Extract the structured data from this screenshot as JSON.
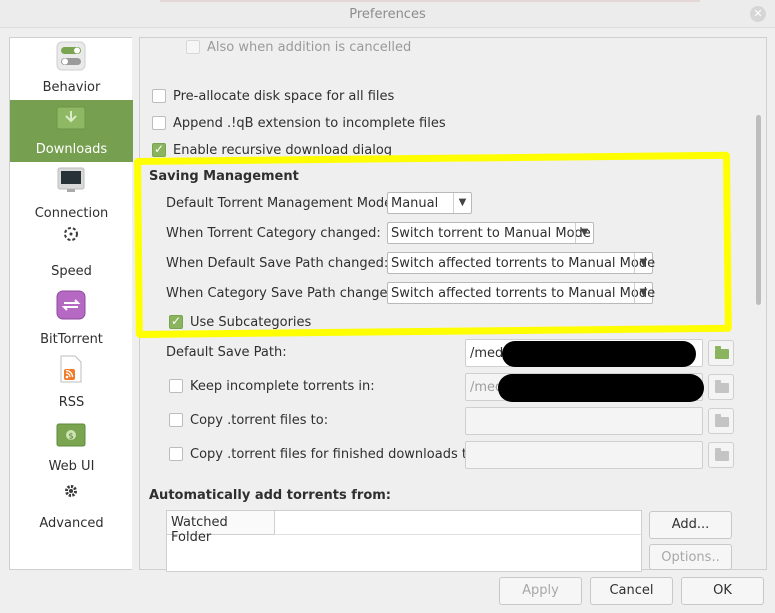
{
  "window": {
    "title": "Preferences"
  },
  "sidebar": {
    "items": [
      {
        "label": "Behavior"
      },
      {
        "label": "Downloads"
      },
      {
        "label": "Connection"
      },
      {
        "label": "Speed"
      },
      {
        "label": "BitTorrent"
      },
      {
        "label": "RSS"
      },
      {
        "label": "Web UI"
      },
      {
        "label": "Advanced"
      }
    ]
  },
  "main": {
    "also_cancelled": "Also when addition is cancelled",
    "preallocate": "Pre-allocate disk space for all files",
    "append_ext": "Append .!qB extension to incomplete files",
    "recursive": "Enable recursive download dialog",
    "saving": {
      "heading": "Saving Management",
      "mode_label": "Default Torrent Management Mode:",
      "mode_value": "Manual",
      "cat_changed_label": "When Torrent Category changed:",
      "cat_changed_value": "Switch torrent to Manual Mode",
      "default_path_changed_label": "When Default Save Path changed:",
      "default_path_changed_value": "Switch affected torrents to Manual Mode",
      "cat_path_changed_label": "When Category Save Path changed:",
      "cat_path_changed_value": "Switch affected torrents to Manual Mode",
      "subcategories": "Use Subcategories"
    },
    "default_save_path_label": "Default Save Path:",
    "default_save_path_value": "/med",
    "keep_incomplete_label": "Keep incomplete torrents in:",
    "keep_incomplete_value": "/med",
    "copy_torrent_label": "Copy .torrent files to:",
    "copy_finished_label": "Copy .torrent files for finished downloads to:",
    "auto_add_heading": "Automatically add torrents from:",
    "watched_header": "Watched Folder",
    "add_button": "Add...",
    "options_button": "Options.."
  },
  "footer": {
    "apply": "Apply",
    "cancel": "Cancel",
    "ok": "OK"
  },
  "colors": {
    "accent": "#76a050",
    "highlight": "#ffff00"
  }
}
